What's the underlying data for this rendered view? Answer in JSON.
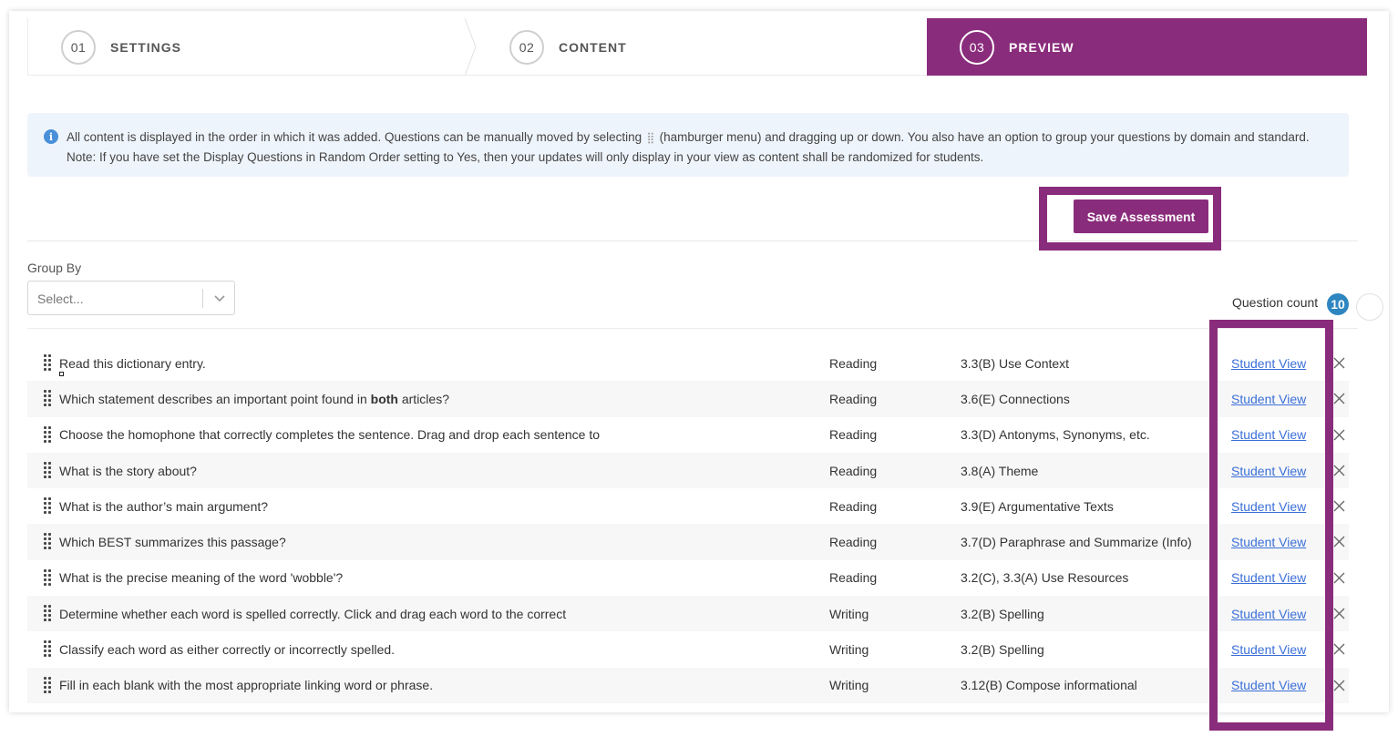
{
  "stepper": {
    "steps": [
      {
        "num": "01",
        "label": "SETTINGS"
      },
      {
        "num": "02",
        "label": "CONTENT"
      },
      {
        "num": "03",
        "label": "PREVIEW"
      }
    ],
    "active_color": "#8a2c7c"
  },
  "info": {
    "icon": "info-icon",
    "text_before": "All content is displayed in the order in which it was added. Questions can be manually moved by selecting",
    "text_after": "(hamburger menu) and dragging up or down. You also have an option to group your questions by domain and standard. Note: If you have set the Display Questions in Random Order setting to Yes, then your updates will only display in your view as content shall be randomized for students."
  },
  "save_button": "Save Assessment",
  "group_by": {
    "label": "Group By",
    "placeholder": "Select..."
  },
  "question_count": {
    "label": "Question count",
    "value": "10"
  },
  "questions": [
    {
      "pre": "Read this dictionary entry.",
      "bold": "",
      "post": "",
      "domain": "Reading",
      "standard": "3.3(B) Use Context",
      "link": "Student View"
    },
    {
      "pre": "Which statement describes an important point found in ",
      "bold": "both",
      "post": " articles?",
      "domain": "Reading",
      "standard": "3.6(E) Connections",
      "link": "Student View"
    },
    {
      "pre": "Choose the homophone that correctly completes the sentence. Drag and drop each sentence to",
      "bold": "",
      "post": "",
      "domain": "Reading",
      "standard": "3.3(D) Antonyms, Synonyms, etc.",
      "link": "Student View"
    },
    {
      "pre": "What is the story about?",
      "bold": "",
      "post": "",
      "domain": "Reading",
      "standard": "3.8(A) Theme",
      "link": "Student View"
    },
    {
      "pre": "What is the author’s main argument?",
      "bold": "",
      "post": "",
      "domain": "Reading",
      "standard": "3.9(E) Argumentative Texts",
      "link": "Student View"
    },
    {
      "pre": "Which BEST summarizes this passage?",
      "bold": "",
      "post": "",
      "domain": "Reading",
      "standard": "3.7(D) Paraphrase and Summarize (Info)",
      "link": "Student View"
    },
    {
      "pre": "What is the precise meaning of the word 'wobble'?",
      "bold": "",
      "post": "",
      "domain": "Reading",
      "standard": "3.2(C), 3.3(A) Use Resources",
      "link": "Student View"
    },
    {
      "pre": "Determine whether each word is spelled correctly. Click and drag each word to the correct",
      "bold": "",
      "post": "",
      "domain": "Writing",
      "standard": "3.2(B) Spelling",
      "link": "Student View"
    },
    {
      "pre": "Classify each word as either correctly or incorrectly spelled.",
      "bold": "",
      "post": "",
      "domain": "Writing",
      "standard": "3.2(B) Spelling",
      "link": "Student View"
    },
    {
      "pre": "Fill in each blank with the most appropriate linking word or phrase.",
      "bold": "",
      "post": "",
      "domain": "Writing",
      "standard": "3.12(B) Compose informational",
      "link": "Student View"
    }
  ]
}
